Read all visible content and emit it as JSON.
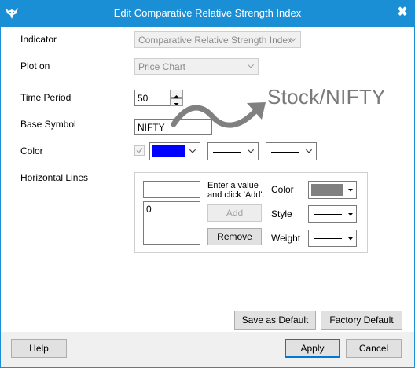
{
  "window": {
    "title": "Edit Comparative Relative Strength Index",
    "close_glyph": "✖"
  },
  "form": {
    "indicator": {
      "label": "Indicator",
      "value": "Comparative Relative Strength Index"
    },
    "plot_on": {
      "label": "Plot on",
      "value": "Price Chart"
    },
    "time_period": {
      "label": "Time Period",
      "value": "50"
    },
    "base_symbol": {
      "label": "Base Symbol",
      "value": "NIFTY"
    },
    "color": {
      "label": "Color",
      "value": "#0000ff",
      "checked": true
    }
  },
  "horizontal_lines": {
    "label": "Horizontal Lines",
    "input_value": "",
    "hint_line1": "Enter a value",
    "hint_line2": "and click 'Add'.",
    "list_items": [
      "0"
    ],
    "add_label": "Add",
    "remove_label": "Remove",
    "color_label": "Color",
    "color_value": "#808080",
    "style_label": "Style",
    "weight_label": "Weight"
  },
  "annotation": {
    "text": "Stock/NIFTY"
  },
  "buttons": {
    "save_default": "Save as Default",
    "factory_default": "Factory Default",
    "help": "Help",
    "apply": "Apply",
    "cancel": "Cancel"
  },
  "colors": {
    "titlebar": "#1b8fd6",
    "accent": "#0078d7",
    "color_swatch": "#0000ff",
    "hline_swatch": "#808080"
  }
}
